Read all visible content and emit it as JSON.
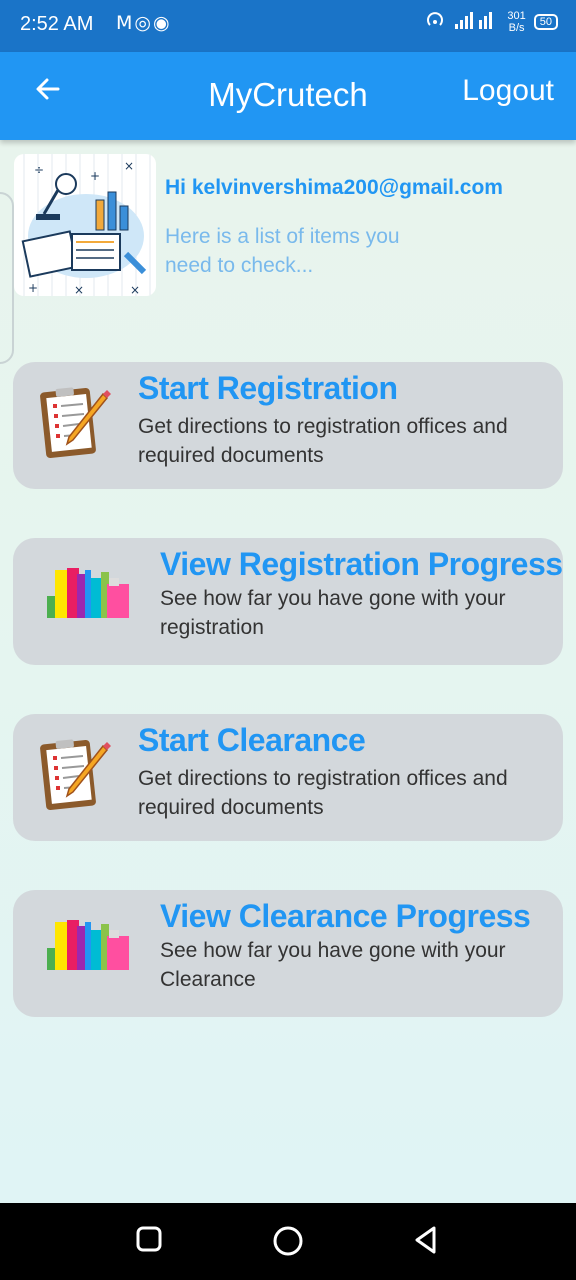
{
  "status_bar": {
    "time": "2:52 AM",
    "notification_icons": "M◎◉",
    "net_speed_value": "301",
    "net_speed_unit": "B/s",
    "network_type": "4G",
    "battery": "50"
  },
  "app_bar": {
    "title": "MyCrutech",
    "logout_label": "Logout",
    "back_icon": "arrow-left-icon"
  },
  "header": {
    "greeting": "Hi kelvinvershima200@gmail.com",
    "subtext": "Here is a list of items you need to check..."
  },
  "cards": [
    {
      "title": "Start Registration",
      "description": "Get directions to registration offices and required documents",
      "icon": "clipboard-pencil-icon"
    },
    {
      "title": "View Registration Progress",
      "description": "See how far you have gone with your registration",
      "icon": "books-icon"
    },
    {
      "title": "Start Clearance",
      "description": "Get directions to registration offices and required documents",
      "icon": "clipboard-pencil-icon"
    },
    {
      "title": "View Clearance Progress",
      "description": "See how far you have gone with your Clearance",
      "icon": "books-icon"
    }
  ],
  "colors": {
    "primary": "#2196f3",
    "status_bar": "#1a74c8",
    "card_bg": "#d3d8dc",
    "subtext": "#79b9ec"
  }
}
